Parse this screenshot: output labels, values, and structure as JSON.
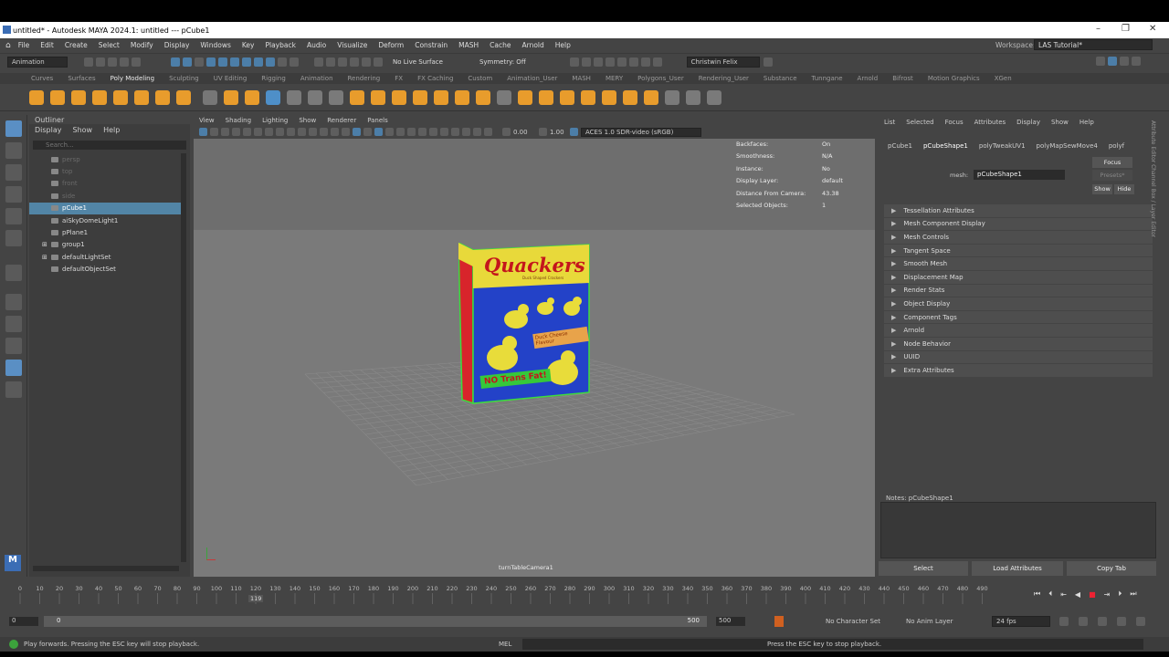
{
  "titlebar": {
    "title": "untitled* - Autodesk MAYA 2024.1: untitled --- pCube1"
  },
  "menubar": {
    "items": [
      "File",
      "Edit",
      "Create",
      "Select",
      "Modify",
      "Display",
      "Windows",
      "Key",
      "Playback",
      "Audio",
      "Visualize",
      "Deform",
      "Constrain",
      "MASH",
      "Cache",
      "Arnold",
      "Help"
    ],
    "workspace_label": "Workspace:",
    "workspace_value": "LAS Tutorial*"
  },
  "statusline": {
    "menu_set": "Animation",
    "live_surface": "No Live Surface",
    "symmetry": "Symmetry: Off",
    "user": "Christwin Felix"
  },
  "shelf": {
    "tabs": [
      "Curves",
      "Surfaces",
      "Poly Modeling",
      "Sculpting",
      "UV Editing",
      "Rigging",
      "Animation",
      "Rendering",
      "FX",
      "FX Caching",
      "Custom",
      "Animation_User",
      "MASH",
      "MERY",
      "Polygons_User",
      "Rendering_User",
      "Substance",
      "Tunngane",
      "Arnold",
      "Bifrost",
      "Motion Graphics",
      "XGen"
    ],
    "active": "Poly Modeling"
  },
  "outliner": {
    "title": "Outliner",
    "menu": [
      "Display",
      "Show",
      "Help"
    ],
    "search_placeholder": "Search...",
    "items": [
      {
        "label": "persp",
        "state": "dim"
      },
      {
        "label": "top",
        "state": "dim"
      },
      {
        "label": "front",
        "state": "dim"
      },
      {
        "label": "side",
        "state": "dim"
      },
      {
        "label": "pCube1",
        "state": "sel"
      },
      {
        "label": "aiSkyDomeLight1",
        "state": ""
      },
      {
        "label": "pPlane1",
        "state": ""
      },
      {
        "label": "group1",
        "state": ""
      },
      {
        "label": "defaultLightSet",
        "state": ""
      },
      {
        "label": "defaultObjectSet",
        "state": ""
      }
    ]
  },
  "viewport": {
    "menu": [
      "View",
      "Shading",
      "Lighting",
      "Show",
      "Renderer",
      "Panels"
    ],
    "exposure": "0.00",
    "gamma": "1.00",
    "color_space": "ACES 1.0 SDR-video (sRGB)",
    "camera": "turnTableCamera1",
    "hud": [
      {
        "k": "Backfaces:",
        "v": "On"
      },
      {
        "k": "Smoothness:",
        "v": "N/A"
      },
      {
        "k": "Instance:",
        "v": "No"
      },
      {
        "k": "Display Layer:",
        "v": "default"
      },
      {
        "k": "Distance From Camera:",
        "v": "43.38"
      },
      {
        "k": "Selected Objects:",
        "v": "1"
      }
    ],
    "box": {
      "brand": "Quackers",
      "tagline": "Duck Shaped Crackers",
      "badge": "Duck Cheese Flavour",
      "bottom": "NO Trans Fat!"
    }
  },
  "attribute_editor": {
    "menu": [
      "List",
      "Selected",
      "Focus",
      "Attributes",
      "Display",
      "Show",
      "Help"
    ],
    "tabs": [
      "pCube1",
      "pCubeShape1",
      "polyTweakUV1",
      "polyMapSewMove4",
      "polyf"
    ],
    "mesh_label": "mesh:",
    "mesh_value": "pCubeShape1",
    "focus": "Focus",
    "presets": "Presets*",
    "show": "Show",
    "hide": "Hide",
    "sections": [
      "Tessellation Attributes",
      "Mesh Component Display",
      "Mesh Controls",
      "Tangent Space",
      "Smooth Mesh",
      "Displacement Map",
      "Render Stats",
      "Object Display",
      "Component Tags",
      "Arnold",
      "Node Behavior",
      "UUID",
      "Extra Attributes"
    ],
    "notes": "Notes:  pCubeShape1",
    "buttons": [
      "Select",
      "Load Attributes",
      "Copy Tab"
    ],
    "side_tabs": "Attribute Editor   Channel Box / Layer Editor"
  },
  "timeline": {
    "ticks": [
      "0",
      "10",
      "20",
      "30",
      "40",
      "50",
      "60",
      "70",
      "80",
      "90",
      "100",
      "110",
      "120",
      "130",
      "140",
      "150",
      "160",
      "170",
      "180",
      "190",
      "200",
      "210",
      "220",
      "230",
      "240",
      "250",
      "260",
      "270",
      "280",
      "290",
      "300",
      "310",
      "320",
      "330",
      "340",
      "350",
      "360",
      "370",
      "380",
      "390",
      "400",
      "410",
      "420",
      "430",
      "440",
      "450",
      "460",
      "470",
      "480",
      "490"
    ],
    "current": "119"
  },
  "range": {
    "start": "0",
    "inner_start": "0",
    "inner_end": "500",
    "end": "500",
    "character_set": "No Character Set",
    "anim_layer": "No Anim Layer",
    "fps": "24 fps"
  },
  "cmdline": {
    "help": "Play forwards. Pressing the ESC key will stop playback.",
    "lang": "MEL",
    "result": "Press the ESC key to stop playback."
  }
}
